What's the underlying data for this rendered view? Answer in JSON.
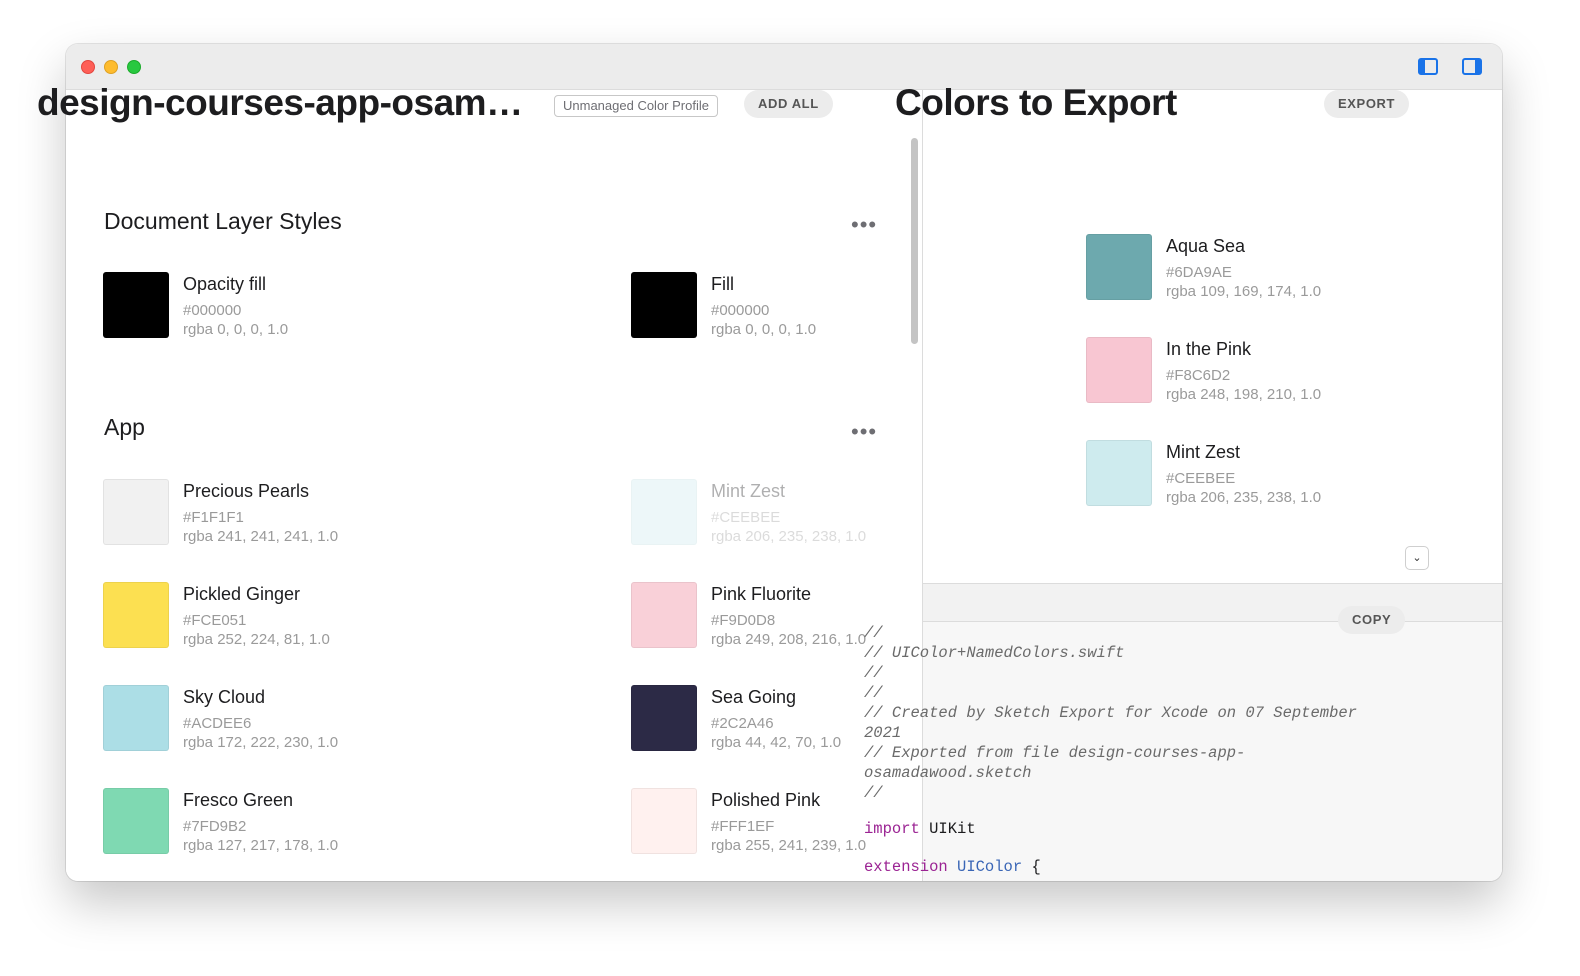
{
  "window": {
    "toolbar": {
      "left_sidebar_icon": "sidebar-left-icon",
      "right_sidebar_icon": "sidebar-right-icon"
    }
  },
  "document": {
    "title": "design-courses-app-osamadawood",
    "profile_badge": "Unmanaged Color Profile",
    "add_all_label": "ADD ALL",
    "more_icon": "ellipsis-icon",
    "sections": [
      {
        "title": "Document Layer Styles",
        "colors": [
          {
            "name": "Opacity fill",
            "hex": "#000000",
            "rgba": "rgba 0, 0, 0, 1.0",
            "color": "#000000"
          },
          {
            "name": "Fill",
            "hex": "#000000",
            "rgba": "rgba 0, 0, 0, 1.0",
            "color": "#000000"
          }
        ]
      },
      {
        "title": "App",
        "colors": [
          {
            "name": "Precious Pearls",
            "hex": "#F1F1F1",
            "rgba": "rgba 241, 241, 241, 1.0",
            "color": "#F1F1F1"
          },
          {
            "name": "Mint Zest",
            "hex": "#CEEBEE",
            "rgba": "rgba 206, 235, 238, 1.0",
            "color": "#CEEBEE"
          },
          {
            "name": "Pickled Ginger",
            "hex": "#FCE051",
            "rgba": "rgba 252, 224, 81, 1.0",
            "color": "#FCE051"
          },
          {
            "name": "Pink Fluorite",
            "hex": "#F9D0D8",
            "rgba": "rgba 249, 208, 216, 1.0",
            "color": "#F9D0D8"
          },
          {
            "name": "Sky Cloud",
            "hex": "#ACDEE6",
            "rgba": "rgba 172, 222, 230, 1.0",
            "color": "#ACDEE6"
          },
          {
            "name": "Sea Going",
            "hex": "#2C2A46",
            "rgba": "rgba 44, 42, 70, 1.0",
            "color": "#2C2A46"
          },
          {
            "name": "Fresco Green",
            "hex": "#7FD9B2",
            "rgba": "rgba 127, 217, 178, 1.0",
            "color": "#7FD9B2"
          },
          {
            "name": "Polished Pink",
            "hex": "#FFF1EF",
            "rgba": "rgba 255, 241, 239, 1.0",
            "color": "#FFF1EF"
          }
        ]
      }
    ]
  },
  "export_panel": {
    "title": "Colors to Export",
    "export_label": "EXPORT",
    "colors": [
      {
        "name": "Aqua Sea",
        "hex": "#6DA9AE",
        "rgba": "rgba 109, 169, 174, 1.0",
        "color": "#6DA9AE"
      },
      {
        "name": "In the Pink",
        "hex": "#F8C6D2",
        "rgba": "rgba 248, 198, 210, 1.0",
        "color": "#F8C6D2"
      },
      {
        "name": "Mint Zest",
        "hex": "#CEEBEE",
        "rgba": "rgba 206, 235, 238, 1.0",
        "color": "#CEEBEE"
      }
    ]
  },
  "code_panel": {
    "collapse_icon": "chevron-down-icon",
    "copy_label": "COPY",
    "lines": [
      "//",
      "// UIColor+NamedColors.swift",
      "//",
      "//",
      "// Created by Sketch Export for Xcode on 07 September",
      "2021",
      "// Exported from file design-courses-app-",
      "osamadawood.sketch",
      "//"
    ],
    "import_keyword": "import",
    "import_module": "UIKit",
    "extension_keyword": "extension",
    "extension_type": "UIColor",
    "brace": "{"
  },
  "theme": {
    "accent": "#1a73e8",
    "close": "#fe5f57",
    "minimize": "#febc2e",
    "zoom": "#28c840"
  }
}
